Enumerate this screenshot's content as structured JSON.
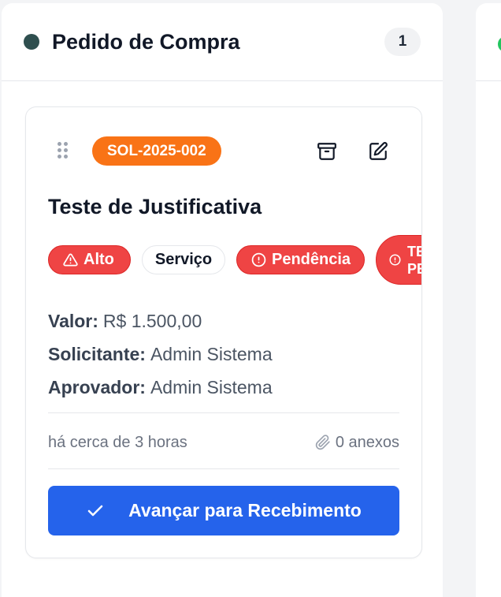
{
  "column": {
    "title": "Pedido de Compra",
    "count": "1",
    "dot_color": "#2f4f4f"
  },
  "next_column": {
    "dot_color": "#22c55e"
  },
  "card": {
    "code": "SOL-2025-002",
    "title": "Teste de Justificativa",
    "tags": {
      "priority": "Alto",
      "type": "Serviço",
      "pending": "Pendência",
      "custom_line1": "TESTE",
      "custom_line2": "PENDÊNCIA"
    },
    "details": {
      "value_label": "Valor:",
      "value": "R$ 1.500,00",
      "requester_label": "Solicitante:",
      "requester": "Admin Sistema",
      "approver_label": "Aprovador:",
      "approver": "Admin Sistema"
    },
    "time_ago": "há cerca de 3 horas",
    "attachments": "0 anexos",
    "action_label": "Avançar para Recebimento",
    "icons": [
      "drag-handle-icon",
      "archive-icon",
      "edit-icon",
      "alert-triangle-icon",
      "alert-circle-icon",
      "paperclip-icon",
      "check-icon"
    ],
    "colors": {
      "code_badge": "#f97316",
      "danger": "#ef4444",
      "primary": "#2563eb"
    }
  }
}
